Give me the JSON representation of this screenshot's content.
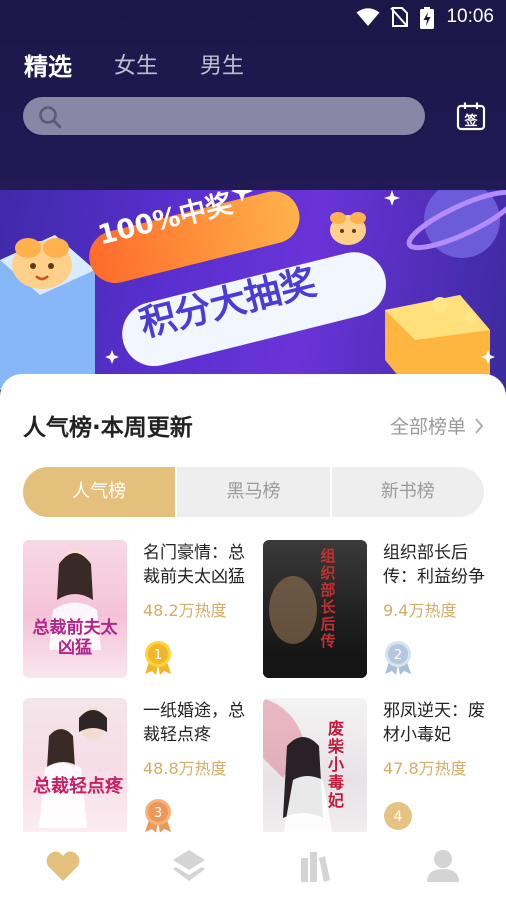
{
  "status": {
    "time": "10:06"
  },
  "tabs": [
    {
      "label": "精选",
      "active": true
    },
    {
      "label": "女生",
      "active": false
    },
    {
      "label": "男生",
      "active": false
    }
  ],
  "search": {
    "placeholder": ""
  },
  "checkin": {
    "label": "签"
  },
  "banner": {
    "line1": "100%中奖",
    "line2": "积分大抽奖"
  },
  "section": {
    "title": "人气榜·本周更新",
    "more": "全部榜单"
  },
  "rank_tabs": [
    {
      "label": "人气榜",
      "active": true
    },
    {
      "label": "黑马榜",
      "active": false
    },
    {
      "label": "新书榜",
      "active": false
    }
  ],
  "books": [
    {
      "rank": "1",
      "title": "名门豪情：总裁前夫太凶猛",
      "heat": "48.2万热度",
      "cover_text": "总裁前夫太凶猛"
    },
    {
      "rank": "2",
      "title": "组织部长后传：利益纷争",
      "heat": "9.4万热度",
      "cover_text": "组织部长后传"
    },
    {
      "rank": "3",
      "title": "一纸婚途，总裁轻点疼",
      "heat": "48.8万热度",
      "cover_text": "总裁轻点疼"
    },
    {
      "rank": "4",
      "title": "邪凤逆天：废材小毒妃",
      "heat": "47.8万热度",
      "cover_text": "废柴小毒妃"
    }
  ],
  "colors": {
    "accent": "#e3c07c",
    "heat": "#d5ad66",
    "header": "#1e1850"
  },
  "nav": [
    {
      "icon": "heart-icon",
      "active": true
    },
    {
      "icon": "layers-icon",
      "active": false
    },
    {
      "icon": "bookshelf-icon",
      "active": false
    },
    {
      "icon": "user-icon",
      "active": false
    }
  ]
}
